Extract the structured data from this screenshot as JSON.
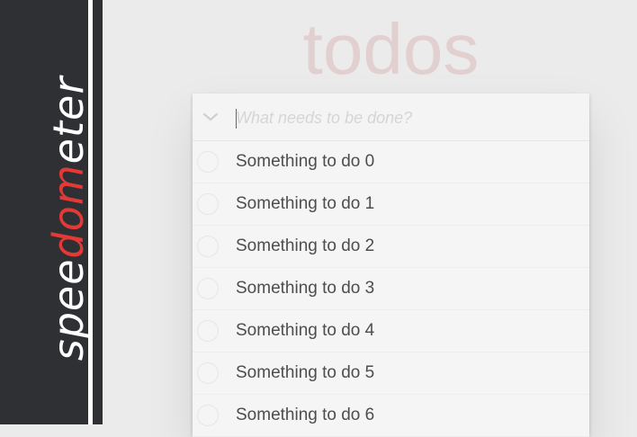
{
  "sidebar": {
    "logo_parts": [
      "spee",
      "dom",
      "eter"
    ],
    "accent_color": "#e53935"
  },
  "app": {
    "title": "todos",
    "new_todo": {
      "value": "",
      "placeholder": "What needs to be done?"
    },
    "toggle_icon": "chevron-down-icon",
    "todos": [
      {
        "label": "Something to do 0",
        "completed": false
      },
      {
        "label": "Something to do 1",
        "completed": false
      },
      {
        "label": "Something to do 2",
        "completed": false
      },
      {
        "label": "Something to do 3",
        "completed": false
      },
      {
        "label": "Something to do 4",
        "completed": false
      },
      {
        "label": "Something to do 5",
        "completed": false
      },
      {
        "label": "Something to do 6",
        "completed": false
      }
    ]
  }
}
